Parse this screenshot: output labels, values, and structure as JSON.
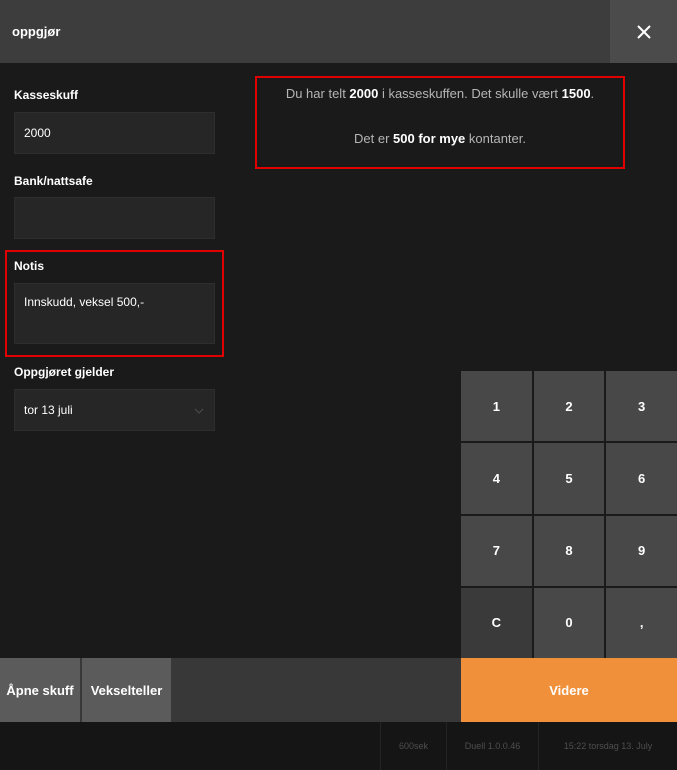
{
  "header": {
    "title": "oppgjør"
  },
  "icons": {
    "close": "close-icon",
    "chevron": "chevron-down-icon"
  },
  "form": {
    "kasseskuff_label": "Kasseskuff",
    "kasseskuff_value": "2000",
    "bank_label": "Bank/nattsafe",
    "bank_value": "",
    "notis_label": "Notis",
    "notis_value": "Innskudd, veksel 500,-",
    "oppgjor_label": "Oppgjøret gjelder",
    "oppgjor_value": "tor 13 juli"
  },
  "summary": {
    "line1_pre": "Du har telt ",
    "counted": "2000",
    "line1_mid": " i kasseskuffen. Det skulle vært ",
    "expected": "1500",
    "line1_post": ".",
    "line2_pre": "Det er ",
    "difference": "500 for mye",
    "line2_post": " kontanter."
  },
  "numpad": {
    "keys": [
      "1",
      "2",
      "3",
      "4",
      "5",
      "6",
      "7",
      "8",
      "9",
      "C",
      "0",
      ","
    ]
  },
  "buttons": {
    "open_drawer": "Åpne skuff",
    "change_counter": "Vekselteller",
    "next": "Videre"
  },
  "status": {
    "item1": "600sek",
    "item2": "Duell 1.0.0.46",
    "item3": "15:22 torsdag 13. July"
  },
  "colors": {
    "accent": "#f0903a",
    "highlight": "#e00000",
    "background": "#1a1a1a",
    "header": "#3d3d3d"
  }
}
